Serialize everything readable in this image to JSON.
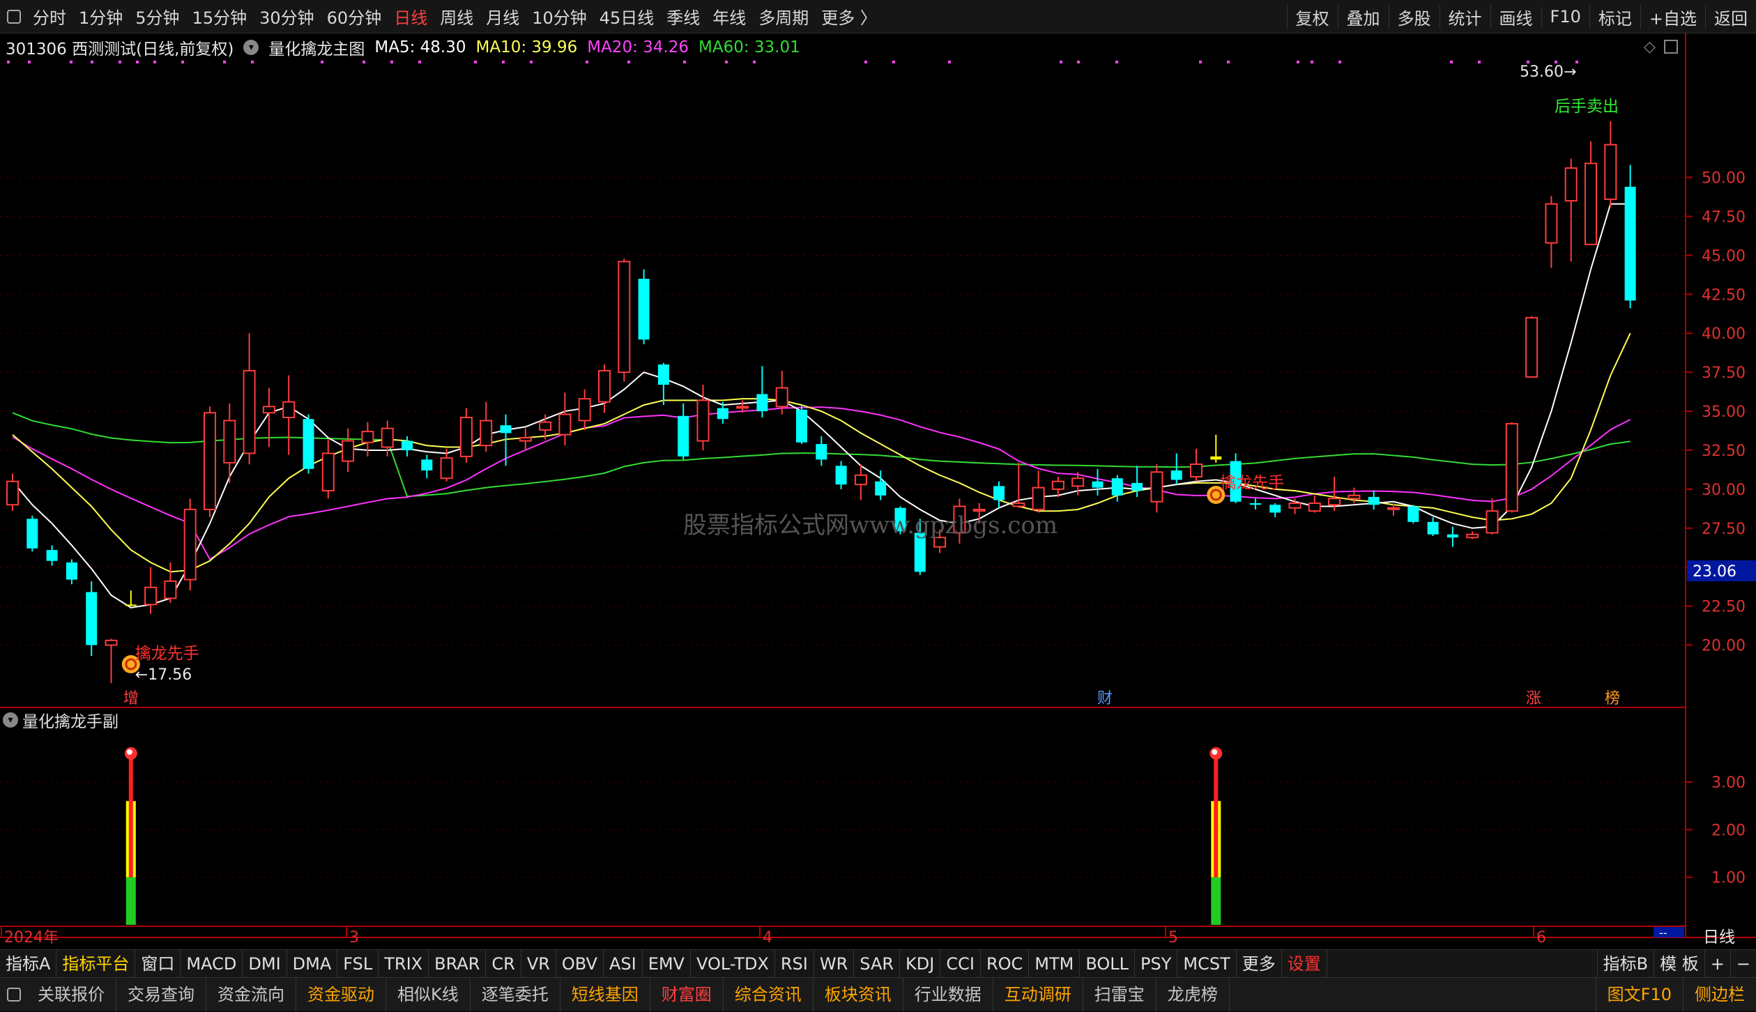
{
  "topbar": {
    "periods": [
      "分时",
      "1分钟",
      "5分钟",
      "15分钟",
      "30分钟",
      "60分钟",
      "日线",
      "周线",
      "月线",
      "10分钟",
      "45日线",
      "季线",
      "年线",
      "多周期",
      "更多 〉"
    ],
    "active_period": "日线",
    "right": [
      "复权",
      "叠加",
      "多股",
      "统计",
      "画线",
      "F10",
      "标记",
      "+自选",
      "返回"
    ]
  },
  "info": {
    "code_title": "301306 西测测试(日线,前复权)",
    "indicator": "量化擒龙主图",
    "ma5": "MA5: 48.30",
    "ma10": "MA10: 39.96",
    "ma20": "MA20: 34.26",
    "ma60": "MA60: 33.01"
  },
  "colors": {
    "up": "#ff3c3c",
    "down": "#00ffff",
    "ma5": "#ffffff",
    "ma10": "#ffff55",
    "ma20": "#ff33ff",
    "ma60": "#33dd33",
    "axis": "#b00000",
    "signal": "#ffff00"
  },
  "chart_data": {
    "type": "candlestick",
    "x_month_labels": [
      "2024年",
      "3",
      "4",
      "5",
      "6"
    ],
    "y_ticks": [
      "50.00",
      "47.50",
      "45.00",
      "42.50",
      "40.00",
      "37.50",
      "35.00",
      "32.50",
      "30.00",
      "27.50",
      "25.00",
      "22.50",
      "20.00"
    ],
    "ylim": [
      16,
      57
    ],
    "current_price_label": "23.06",
    "annotations": {
      "high": "53.60",
      "low": "17.56",
      "signal_1": "擒龙先手",
      "signal_2": "擒龙先手",
      "sell": "后手卖出"
    },
    "event_markers": [
      "增",
      "财",
      "涨",
      "榜"
    ],
    "candles": [
      [
        29,
        30.5,
        28.6,
        31
      ],
      [
        28.1,
        26.2,
        26,
        28.3
      ],
      [
        26.1,
        25.4,
        25.1,
        26.4
      ],
      [
        25.3,
        24.2,
        23.9,
        25.5
      ],
      [
        23.4,
        20,
        19.3,
        24.1
      ],
      [
        20,
        20.3,
        17.56,
        20.4
      ],
      [
        22.6,
        22.6,
        22.5,
        23.5
      ],
      [
        22.6,
        23.7,
        22,
        25
      ],
      [
        23,
        24.1,
        22.7,
        25.3
      ],
      [
        24.2,
        28.7,
        23.5,
        29.4
      ],
      [
        28.7,
        34.9,
        28.2,
        35.3
      ],
      [
        31.7,
        34.4,
        30.4,
        35.5
      ],
      [
        32.3,
        37.6,
        31.6,
        40
      ],
      [
        34.9,
        35.3,
        32.7,
        36.5
      ],
      [
        34.6,
        35.6,
        32.2,
        37.3
      ],
      [
        34.5,
        31.3,
        31,
        34.8
      ],
      [
        29.9,
        32.3,
        29.4,
        33.2
      ],
      [
        31.8,
        33.1,
        31.1,
        33.9
      ],
      [
        33,
        33.7,
        32.1,
        34.3
      ],
      [
        32.7,
        33.9,
        32.1,
        34.4
      ],
      [
        33.1,
        32.5,
        32.1,
        33.4
      ],
      [
        31.9,
        31.2,
        30.7,
        32.2
      ],
      [
        30.7,
        32,
        30.5,
        32.6
      ],
      [
        32.1,
        34.6,
        31.7,
        35.2
      ],
      [
        32.8,
        34.4,
        32.4,
        35.6
      ],
      [
        34.1,
        33.6,
        31.5,
        34.8
      ],
      [
        33.1,
        33.3,
        32.5,
        33.9
      ],
      [
        33.8,
        34.3,
        33.2,
        34.8
      ],
      [
        33.5,
        34.8,
        32.8,
        36.2
      ],
      [
        34.4,
        35.8,
        33.8,
        36.4
      ],
      [
        35.6,
        37.6,
        34.9,
        38
      ],
      [
        37.5,
        44.6,
        36.9,
        44.8
      ],
      [
        43.5,
        39.6,
        39.3,
        44.1
      ],
      [
        38,
        36.7,
        35.4,
        38.1
      ],
      [
        34.7,
        32.1,
        31.9,
        35.5
      ],
      [
        33.1,
        35.7,
        32.5,
        36.7
      ],
      [
        35.2,
        34.5,
        34.2,
        35.6
      ],
      [
        35.3,
        35.3,
        34.9,
        35.7
      ],
      [
        36.1,
        35,
        34.6,
        37.9
      ],
      [
        35.3,
        36.5,
        34.8,
        37.6
      ],
      [
        35.1,
        33,
        32.9,
        35.4
      ],
      [
        32.9,
        31.9,
        31.5,
        33.4
      ],
      [
        31.5,
        30.3,
        30,
        31.8
      ],
      [
        30.3,
        30.9,
        29.3,
        31.6
      ],
      [
        30.5,
        29.6,
        29.3,
        31.2
      ],
      [
        28.8,
        27.3,
        27.1,
        28.9
      ],
      [
        27.2,
        24.7,
        24.5,
        28.1
      ],
      [
        26.3,
        26.9,
        25.9,
        27.4
      ],
      [
        27.2,
        28.9,
        26.5,
        29.4
      ],
      [
        28.6,
        28.7,
        27.8,
        29.1
      ],
      [
        30.2,
        29.3,
        28.8,
        30.5
      ],
      [
        28.9,
        29.1,
        28.8,
        31.7
      ],
      [
        28.7,
        30.1,
        28.5,
        31.2
      ],
      [
        30,
        30.5,
        29.5,
        30.8
      ],
      [
        30.2,
        30.7,
        29.6,
        31.1
      ],
      [
        30.5,
        30.1,
        29.6,
        31.3
      ],
      [
        30.7,
        29.6,
        29.2,
        30.9
      ],
      [
        30.4,
        29.9,
        29.5,
        31.5
      ],
      [
        29.2,
        31.1,
        28.5,
        31.6
      ],
      [
        31.2,
        30.6,
        30.3,
        32.3
      ],
      [
        30.8,
        31.6,
        30.5,
        32.6
      ],
      [
        31.9,
        32.1,
        31.7,
        33.5
      ],
      [
        31.8,
        29.2,
        29.1,
        32.3
      ],
      [
        29.1,
        29,
        28.7,
        29.4
      ],
      [
        29,
        28.5,
        28.2,
        29.1
      ],
      [
        28.8,
        29.1,
        28.4,
        29.4
      ],
      [
        28.6,
        29.1,
        28.5,
        29.6
      ],
      [
        29,
        29.4,
        28.6,
        30.8
      ],
      [
        29.4,
        29.6,
        29.1,
        30.1
      ],
      [
        29.5,
        29,
        28.7,
        29.9
      ],
      [
        28.8,
        28.8,
        28.3,
        29.1
      ],
      [
        28.9,
        27.9,
        27.8,
        29
      ],
      [
        27.9,
        27.1,
        27,
        28.2
      ],
      [
        27.1,
        26.9,
        26.3,
        27.6
      ],
      [
        26.9,
        27.1,
        26.8,
        27.3
      ],
      [
        27.2,
        28.6,
        27.1,
        29.4
      ],
      [
        28.6,
        34.2,
        28.5,
        34.3
      ],
      [
        37.2,
        41,
        38.2,
        41.1
      ],
      [
        45.8,
        48.3,
        44.2,
        48.8
      ],
      [
        48.5,
        50.6,
        44.6,
        51.2
      ],
      [
        45.7,
        50.9,
        45.7,
        52.3
      ],
      [
        48.6,
        52.1,
        48.1,
        53.6
      ],
      [
        49.4,
        42.1,
        41.6,
        50.8
      ]
    ],
    "ma5": [
      30.5,
      29,
      27.8,
      26.4,
      24.9,
      23.2,
      22.4,
      22.6,
      23,
      25.2,
      27.8,
      30.8,
      33,
      34.9,
      35.3,
      34.5,
      33.3,
      32.6,
      32.5,
      32.5,
      32.6,
      32.4,
      32.3,
      32.7,
      33.5,
      33.8,
      34,
      34.5,
      35,
      35.2,
      35.5,
      36.4,
      37.5,
      37.1,
      36.6,
      35.9,
      35.4,
      35.5,
      35.6,
      35.7,
      35,
      33.9,
      32.7,
      31.5,
      30.7,
      29.5,
      28.7,
      28,
      27.8,
      28.1,
      28.8,
      29.3,
      29.5,
      29.6,
      29.9,
      30,
      30.1,
      30,
      30.1,
      30.3,
      30.5,
      30.6,
      30.4,
      30,
      29.6,
      29.2,
      28.9,
      28.9,
      29,
      29.1,
      29.2,
      28.9,
      28.3,
      27.8,
      27.5,
      27.6,
      28.9,
      31.4,
      35,
      39.4,
      44.1,
      48.3,
      48.3
    ],
    "ma10": [
      33.5,
      32.4,
      31.3,
      30.1,
      28.9,
      27.4,
      26.1,
      25.3,
      24.7,
      24.8,
      25.4,
      26.5,
      27.8,
      29.5,
      30.7,
      31.5,
      32.1,
      32.6,
      33,
      33.2,
      33.1,
      32.8,
      32.7,
      32.7,
      32.9,
      33.2,
      33.3,
      33.4,
      33.6,
      33.9,
      34.2,
      34.8,
      35.4,
      35.7,
      35.7,
      35.7,
      35.7,
      35.8,
      35.8,
      35.7,
      35.4,
      35,
      34.4,
      33.6,
      32.9,
      32.2,
      31.5,
      30.9,
      30.4,
      29.8,
      29.3,
      28.9,
      28.6,
      28.6,
      28.7,
      29.1,
      29.6,
      29.9,
      30.1,
      30.3,
      30.4,
      30.4,
      30.4,
      30.2,
      30,
      29.9,
      29.7,
      29.5,
      29.3,
      29.2,
      29,
      28.9,
      28.8,
      28.5,
      28.2,
      28,
      28.1,
      28.4,
      29.1,
      30.7,
      33.8,
      37.3,
      40
    ]
  },
  "sub_panel": {
    "title": "量化擒龙手副",
    "y_ticks": [
      "3.00",
      "2.00",
      "1.00"
    ],
    "ylim": [
      0,
      4.2
    ],
    "signal_indices": [
      6,
      61
    ]
  },
  "watermark": "股票指标公式网www.gpzbgs.com",
  "sub_period_label": "日线",
  "bottom_tabs": {
    "left": [
      "指标A",
      "指标平台",
      "窗口",
      "MACD",
      "DMI",
      "DMA",
      "FSL",
      "TRIX",
      "BRAR",
      "CR",
      "VR",
      "OBV",
      "ASI",
      "EMV",
      "VOL-TDX",
      "RSI",
      "WR",
      "SAR",
      "KDJ",
      "CCI",
      "ROC",
      "MTM",
      "BOLL",
      "PSY",
      "MCST",
      "更多",
      "设置"
    ],
    "right": [
      "指标B",
      "模 板",
      "+",
      "−"
    ]
  },
  "func_bar": {
    "left": [
      "关联报价",
      "交易查询",
      "资金流向",
      "资金驱动",
      "相似K线",
      "逐笔委托",
      "短线基因",
      "财富圈",
      "综合资讯",
      "板块资讯",
      "行业数据",
      "互动调研",
      "扫雷宝",
      "龙虎榜"
    ],
    "right": [
      "图文F10",
      "侧边栏"
    ]
  }
}
